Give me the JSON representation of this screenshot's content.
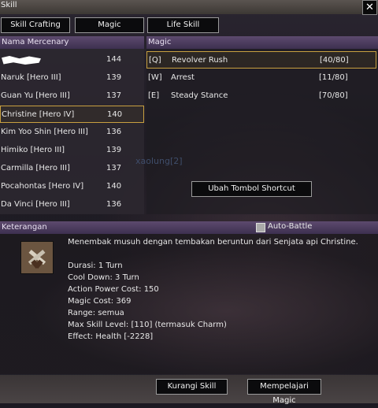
{
  "window": {
    "title": "Skill"
  },
  "tabs": [
    "Skill Crafting",
    "Magic",
    "Life Skill"
  ],
  "mercenary_list": {
    "header": "Nama Mercenary",
    "rows": [
      {
        "name": "",
        "level": "144",
        "censored": true
      },
      {
        "name": "Naruk [Hero III]",
        "level": "139"
      },
      {
        "name": "Guan Yu [Hero III]",
        "level": "137"
      },
      {
        "name": "Christine [Hero IV]",
        "level": "140",
        "selected": true
      },
      {
        "name": "Kim Yoo Shin [Hero III]",
        "level": "136"
      },
      {
        "name": "Himiko [Hero III]",
        "level": "139"
      },
      {
        "name": "Carmilla [Hero III]",
        "level": "137"
      },
      {
        "name": "Pocahontas [Hero IV]",
        "level": "140"
      },
      {
        "name": "Da Vinci [Hero III]",
        "level": "136"
      }
    ]
  },
  "magic_list": {
    "header": "Magic",
    "rows": [
      {
        "key": "[Q]",
        "name": "Revolver Rush",
        "points": "[40/80]",
        "selected": true
      },
      {
        "key": "[W]",
        "name": "Arrest",
        "points": "[11/80]"
      },
      {
        "key": "[E]",
        "name": "Steady Stance",
        "points": "[70/80]"
      }
    ],
    "watermark": "xaolung[2]",
    "shortcut_button": "Ubah Tombol Shortcut"
  },
  "description": {
    "header": "Keterangan",
    "auto_battle_label": "Auto-Battle",
    "auto_battle_checked": false,
    "summary": "Menembak musuh dengan tembakan beruntun dari Senjata api Christine.",
    "lines": [
      "Durasi: 1 Turn",
      "Cool Down: 3 Turn",
      "Action Power Cost: 150",
      "Magic Cost: 369",
      "Range: semua",
      "Max Skill Level: [110] (termasuk Charm)",
      "Effect: Health [-2228]"
    ],
    "icon": "crossed-revolvers-icon"
  },
  "footer": {
    "reduce_button": "Kurangi Skill",
    "learn_button": "Mempelajari Magic"
  },
  "colors": {
    "selection_border": "#c8a040",
    "header_purple": "#4d3d60"
  }
}
